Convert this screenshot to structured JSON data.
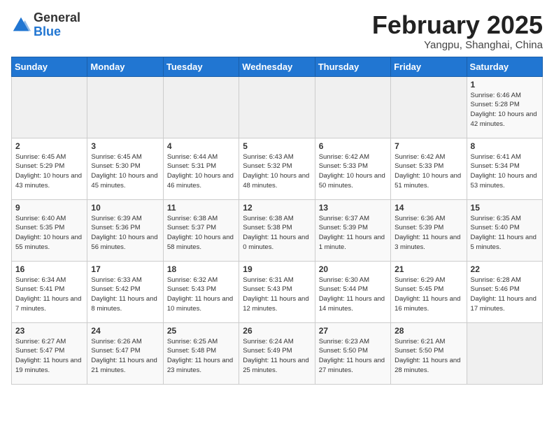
{
  "logo": {
    "general": "General",
    "blue": "Blue"
  },
  "title": "February 2025",
  "subtitle": "Yangpu, Shanghai, China",
  "headers": [
    "Sunday",
    "Monday",
    "Tuesday",
    "Wednesday",
    "Thursday",
    "Friday",
    "Saturday"
  ],
  "weeks": [
    [
      {
        "day": "",
        "info": ""
      },
      {
        "day": "",
        "info": ""
      },
      {
        "day": "",
        "info": ""
      },
      {
        "day": "",
        "info": ""
      },
      {
        "day": "",
        "info": ""
      },
      {
        "day": "",
        "info": ""
      },
      {
        "day": "1",
        "info": "Sunrise: 6:46 AM\nSunset: 5:28 PM\nDaylight: 10 hours and 42 minutes."
      }
    ],
    [
      {
        "day": "2",
        "info": "Sunrise: 6:45 AM\nSunset: 5:29 PM\nDaylight: 10 hours and 43 minutes."
      },
      {
        "day": "3",
        "info": "Sunrise: 6:45 AM\nSunset: 5:30 PM\nDaylight: 10 hours and 45 minutes."
      },
      {
        "day": "4",
        "info": "Sunrise: 6:44 AM\nSunset: 5:31 PM\nDaylight: 10 hours and 46 minutes."
      },
      {
        "day": "5",
        "info": "Sunrise: 6:43 AM\nSunset: 5:32 PM\nDaylight: 10 hours and 48 minutes."
      },
      {
        "day": "6",
        "info": "Sunrise: 6:42 AM\nSunset: 5:33 PM\nDaylight: 10 hours and 50 minutes."
      },
      {
        "day": "7",
        "info": "Sunrise: 6:42 AM\nSunset: 5:33 PM\nDaylight: 10 hours and 51 minutes."
      },
      {
        "day": "8",
        "info": "Sunrise: 6:41 AM\nSunset: 5:34 PM\nDaylight: 10 hours and 53 minutes."
      }
    ],
    [
      {
        "day": "9",
        "info": "Sunrise: 6:40 AM\nSunset: 5:35 PM\nDaylight: 10 hours and 55 minutes."
      },
      {
        "day": "10",
        "info": "Sunrise: 6:39 AM\nSunset: 5:36 PM\nDaylight: 10 hours and 56 minutes."
      },
      {
        "day": "11",
        "info": "Sunrise: 6:38 AM\nSunset: 5:37 PM\nDaylight: 10 hours and 58 minutes."
      },
      {
        "day": "12",
        "info": "Sunrise: 6:38 AM\nSunset: 5:38 PM\nDaylight: 11 hours and 0 minutes."
      },
      {
        "day": "13",
        "info": "Sunrise: 6:37 AM\nSunset: 5:39 PM\nDaylight: 11 hours and 1 minute."
      },
      {
        "day": "14",
        "info": "Sunrise: 6:36 AM\nSunset: 5:39 PM\nDaylight: 11 hours and 3 minutes."
      },
      {
        "day": "15",
        "info": "Sunrise: 6:35 AM\nSunset: 5:40 PM\nDaylight: 11 hours and 5 minutes."
      }
    ],
    [
      {
        "day": "16",
        "info": "Sunrise: 6:34 AM\nSunset: 5:41 PM\nDaylight: 11 hours and 7 minutes."
      },
      {
        "day": "17",
        "info": "Sunrise: 6:33 AM\nSunset: 5:42 PM\nDaylight: 11 hours and 8 minutes."
      },
      {
        "day": "18",
        "info": "Sunrise: 6:32 AM\nSunset: 5:43 PM\nDaylight: 11 hours and 10 minutes."
      },
      {
        "day": "19",
        "info": "Sunrise: 6:31 AM\nSunset: 5:43 PM\nDaylight: 11 hours and 12 minutes."
      },
      {
        "day": "20",
        "info": "Sunrise: 6:30 AM\nSunset: 5:44 PM\nDaylight: 11 hours and 14 minutes."
      },
      {
        "day": "21",
        "info": "Sunrise: 6:29 AM\nSunset: 5:45 PM\nDaylight: 11 hours and 16 minutes."
      },
      {
        "day": "22",
        "info": "Sunrise: 6:28 AM\nSunset: 5:46 PM\nDaylight: 11 hours and 17 minutes."
      }
    ],
    [
      {
        "day": "23",
        "info": "Sunrise: 6:27 AM\nSunset: 5:47 PM\nDaylight: 11 hours and 19 minutes."
      },
      {
        "day": "24",
        "info": "Sunrise: 6:26 AM\nSunset: 5:47 PM\nDaylight: 11 hours and 21 minutes."
      },
      {
        "day": "25",
        "info": "Sunrise: 6:25 AM\nSunset: 5:48 PM\nDaylight: 11 hours and 23 minutes."
      },
      {
        "day": "26",
        "info": "Sunrise: 6:24 AM\nSunset: 5:49 PM\nDaylight: 11 hours and 25 minutes."
      },
      {
        "day": "27",
        "info": "Sunrise: 6:23 AM\nSunset: 5:50 PM\nDaylight: 11 hours and 27 minutes."
      },
      {
        "day": "28",
        "info": "Sunrise: 6:21 AM\nSunset: 5:50 PM\nDaylight: 11 hours and 28 minutes."
      },
      {
        "day": "",
        "info": ""
      }
    ]
  ]
}
